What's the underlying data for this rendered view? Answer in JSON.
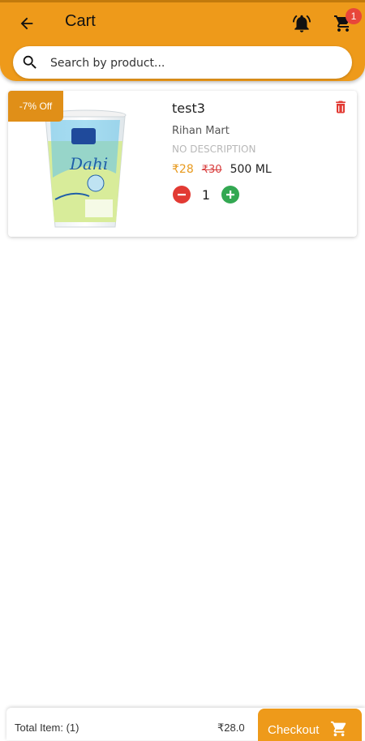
{
  "header": {
    "title": "Cart",
    "cart_count": "1",
    "background_color": "#ee9a1a"
  },
  "search": {
    "placeholder": "Search by product..."
  },
  "cart_items": [
    {
      "discount_label": "-7% Off",
      "name": "test3",
      "store": "Rihan Mart",
      "description": "NO DESCRIPTION",
      "price": "₹28",
      "old_price": "₹30",
      "size": "500 ML",
      "quantity": "1",
      "image_icon": "dahi-cup-image"
    }
  ],
  "footer": {
    "total_items": "Total Item: (1)",
    "total_amount": "₹28.0",
    "checkout_label": "Checkout"
  },
  "colors": {
    "accent": "#ee9a1a",
    "price": "#e89a1e",
    "delete": "#e23a33",
    "increment": "#33a852"
  }
}
